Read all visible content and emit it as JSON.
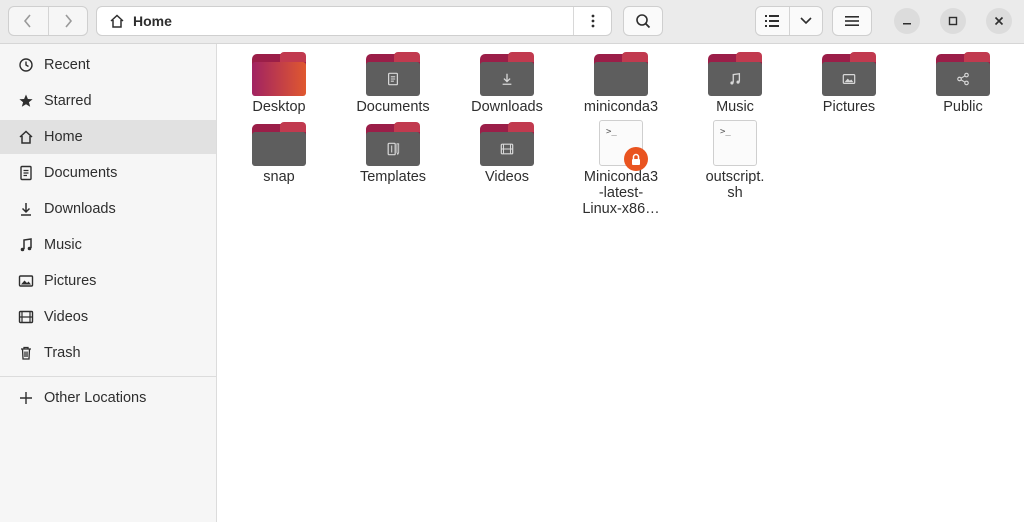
{
  "window": {
    "path_label": "Home"
  },
  "sidebar": {
    "items": [
      {
        "label": "Recent",
        "icon": "clock-icon"
      },
      {
        "label": "Starred",
        "icon": "star-icon"
      },
      {
        "label": "Home",
        "icon": "home-icon",
        "active": true
      },
      {
        "label": "Documents",
        "icon": "document-icon"
      },
      {
        "label": "Downloads",
        "icon": "download-icon"
      },
      {
        "label": "Music",
        "icon": "music-icon"
      },
      {
        "label": "Pictures",
        "icon": "picture-icon"
      },
      {
        "label": "Videos",
        "icon": "video-icon"
      },
      {
        "label": "Trash",
        "icon": "trash-icon"
      }
    ],
    "other_locations": "Other Locations"
  },
  "files": [
    {
      "label": "Desktop",
      "type": "folder",
      "emblem": "none"
    },
    {
      "label": "Documents",
      "type": "folder",
      "emblem": "document-icon"
    },
    {
      "label": "Downloads",
      "type": "folder",
      "emblem": "download-icon"
    },
    {
      "label": "miniconda3",
      "type": "folder",
      "emblem": "none"
    },
    {
      "label": "Music",
      "type": "folder",
      "emblem": "music-icon"
    },
    {
      "label": "Pictures",
      "type": "folder",
      "emblem": "picture-icon"
    },
    {
      "label": "Public",
      "type": "folder",
      "emblem": "share-icon"
    },
    {
      "label": "snap",
      "type": "folder",
      "emblem": "none"
    },
    {
      "label": "Templates",
      "type": "folder",
      "emblem": "template-icon"
    },
    {
      "label": "Videos",
      "type": "folder",
      "emblem": "video-icon"
    },
    {
      "label": "Miniconda3\n-latest-\nLinux-x86…",
      "type": "script",
      "locked": true
    },
    {
      "label": "outscript.\nsh",
      "type": "script",
      "locked": false
    }
  ],
  "colors": {
    "folder_body": "#5e5e5e",
    "folder_tab": "#9b1e48",
    "accent": "#e95420"
  },
  "script_icon_text": ">_"
}
